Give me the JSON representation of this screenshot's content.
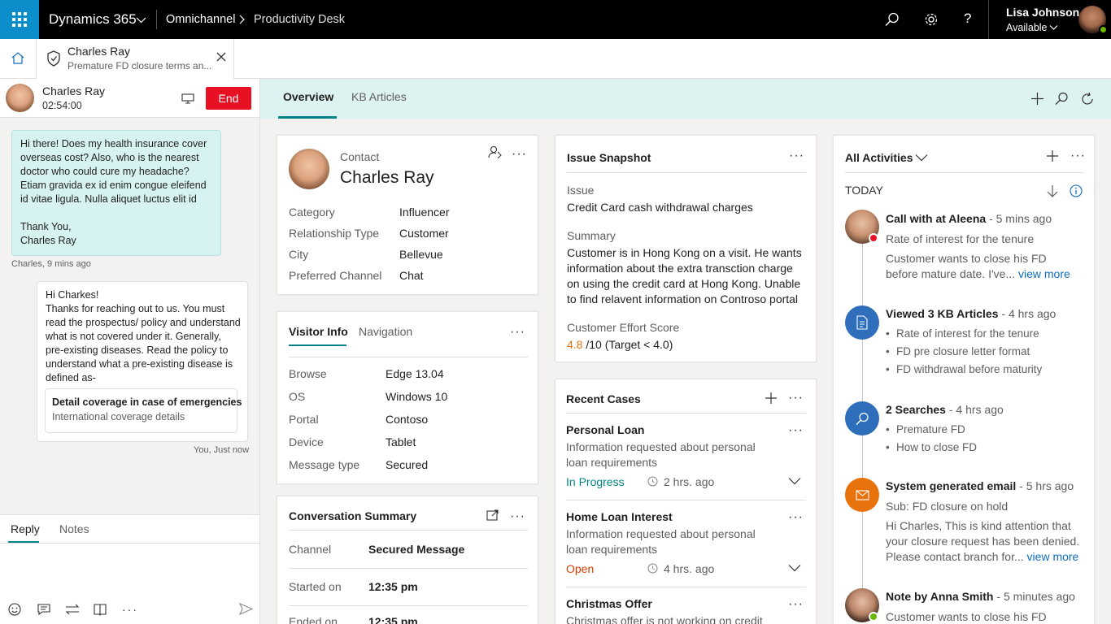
{
  "topbar": {
    "app_name": "Dynamics 365",
    "breadcrumb": [
      "Omnichannel",
      "Productivity Desk"
    ],
    "user_name": "Lisa Johnson",
    "user_status": "Available",
    "colors": {
      "bar": "#000000",
      "waffle": "#0b8ec9"
    }
  },
  "session_tab": {
    "name": "Charles Ray",
    "subtitle": "Premature FD closure terms an..."
  },
  "conversation": {
    "customer_name": "Charles Ray",
    "timer": "02:54:00",
    "end_label": "End",
    "messages": [
      {
        "text": "Hi there! Does my health insurance cover overseas cost? Also, who is the nearest doctor who could cure my headache? Etiam gravida ex id enim congue eleifend id vitae ligula. Nulla aliquet luctus elit id",
        "sign1": "Thank You,",
        "sign2": "Charles Ray",
        "meta": "Charles, 9 mins ago"
      },
      {
        "greet": "Hi Charkes!",
        "text": "Thanks for reaching out to us. You must read the prospectus/ policy and understand what is not covered under it. Generally, pre-existing diseases. Read the policy to understand what a pre-existing disease is defined as-",
        "kb_title": "Detail coverage in case of emergencies",
        "kb_sub": "International coverage details",
        "meta": "You, Just now"
      }
    ],
    "tabs": [
      "Reply",
      "Notes"
    ]
  },
  "main_tabs": [
    "Overview",
    "KB Articles"
  ],
  "contact": {
    "type_label": "Contact",
    "name": "Charles Ray",
    "fields": [
      {
        "label": "Category",
        "value": "Influencer"
      },
      {
        "label": "Relationship Type",
        "value": "Customer"
      },
      {
        "label": "City",
        "value": "Bellevue"
      },
      {
        "label": "Preferred Channel",
        "value": "Chat"
      }
    ]
  },
  "visitor": {
    "tabs": [
      "Visitor Info",
      "Navigation"
    ],
    "fields": [
      {
        "label": "Browse",
        "value": "Edge 13.04"
      },
      {
        "label": "OS",
        "value": "Windows 10"
      },
      {
        "label": "Portal",
        "value": "Contoso"
      },
      {
        "label": "Device",
        "value": "Tablet"
      },
      {
        "label": "Message type",
        "value": "Secured"
      }
    ]
  },
  "conv_summary": {
    "title": "Conversation Summary",
    "fields": [
      {
        "label": "Channel",
        "value": "Secured Message"
      },
      {
        "label": "Started on",
        "value": "12:35 pm"
      },
      {
        "label": "Ended on",
        "value": "12:35 pm"
      }
    ]
  },
  "issue": {
    "title": "Issue Snapshot",
    "issue_label": "Issue",
    "issue_value": "Credit Card cash withdrawal charges",
    "summary_label": "Summary",
    "summary_value": "Customer is in Hong Kong on a visit. He wants information about the extra transction charge on using the credit card at Hong Kong. Unable to find relavent information on Controso portal",
    "score_label": "Customer Effort Score",
    "score": "4.8",
    "score_rest": "/10 (Target < 4.0)",
    "score_color": "#e8730c"
  },
  "recent_cases": {
    "title": "Recent Cases",
    "cases": [
      {
        "title": "Personal Loan",
        "desc": "Information requested about personal loan requirements",
        "status": "In Progress",
        "status_color": "#038387",
        "time": "2 hrs. ago"
      },
      {
        "title": "Home Loan Interest",
        "desc": "Information requested about personal loan requirements",
        "status": "Open",
        "status_color": "#d83b01",
        "time": "4 hrs. ago"
      },
      {
        "title": "Christmas Offer",
        "desc": "Christmas offer is not working on credit"
      }
    ]
  },
  "activities": {
    "title": "All Activities",
    "group": "TODAY",
    "items": [
      {
        "title": "Call with at Aleena",
        "time": " - 5 mins ago",
        "line1": "Rate of interest for the tenure",
        "line2": "Customer wants to close his FD",
        "line3": "before mature date. I've...",
        "more": "view more"
      },
      {
        "title": "Viewed 3 KB Articles",
        "time": " - 4 hrs ago",
        "bullets": [
          "Rate of interest for the tenure",
          "FD pre closure letter format",
          "FD withdrawal before maturity"
        ],
        "color": "#2f6eba"
      },
      {
        "title": "2 Searches",
        "time": " - 4 hrs ago",
        "bullets": [
          "Premature FD",
          "How to close FD"
        ],
        "color": "#2f6eba"
      },
      {
        "title": "System generated email",
        "time": " - 5 hrs ago",
        "line1": "Sub: FD closure on hold",
        "line2": "Hi Charles, This is kind attention that",
        "line3": "your closure request has been denied.",
        "line4": "Please contact branch for...",
        "more": "view more",
        "color": "#e8730c"
      },
      {
        "title": "Note by Anna Smith",
        "time": " - 5 minutes ago",
        "line1": "Customer wants to close his FD"
      }
    ]
  }
}
